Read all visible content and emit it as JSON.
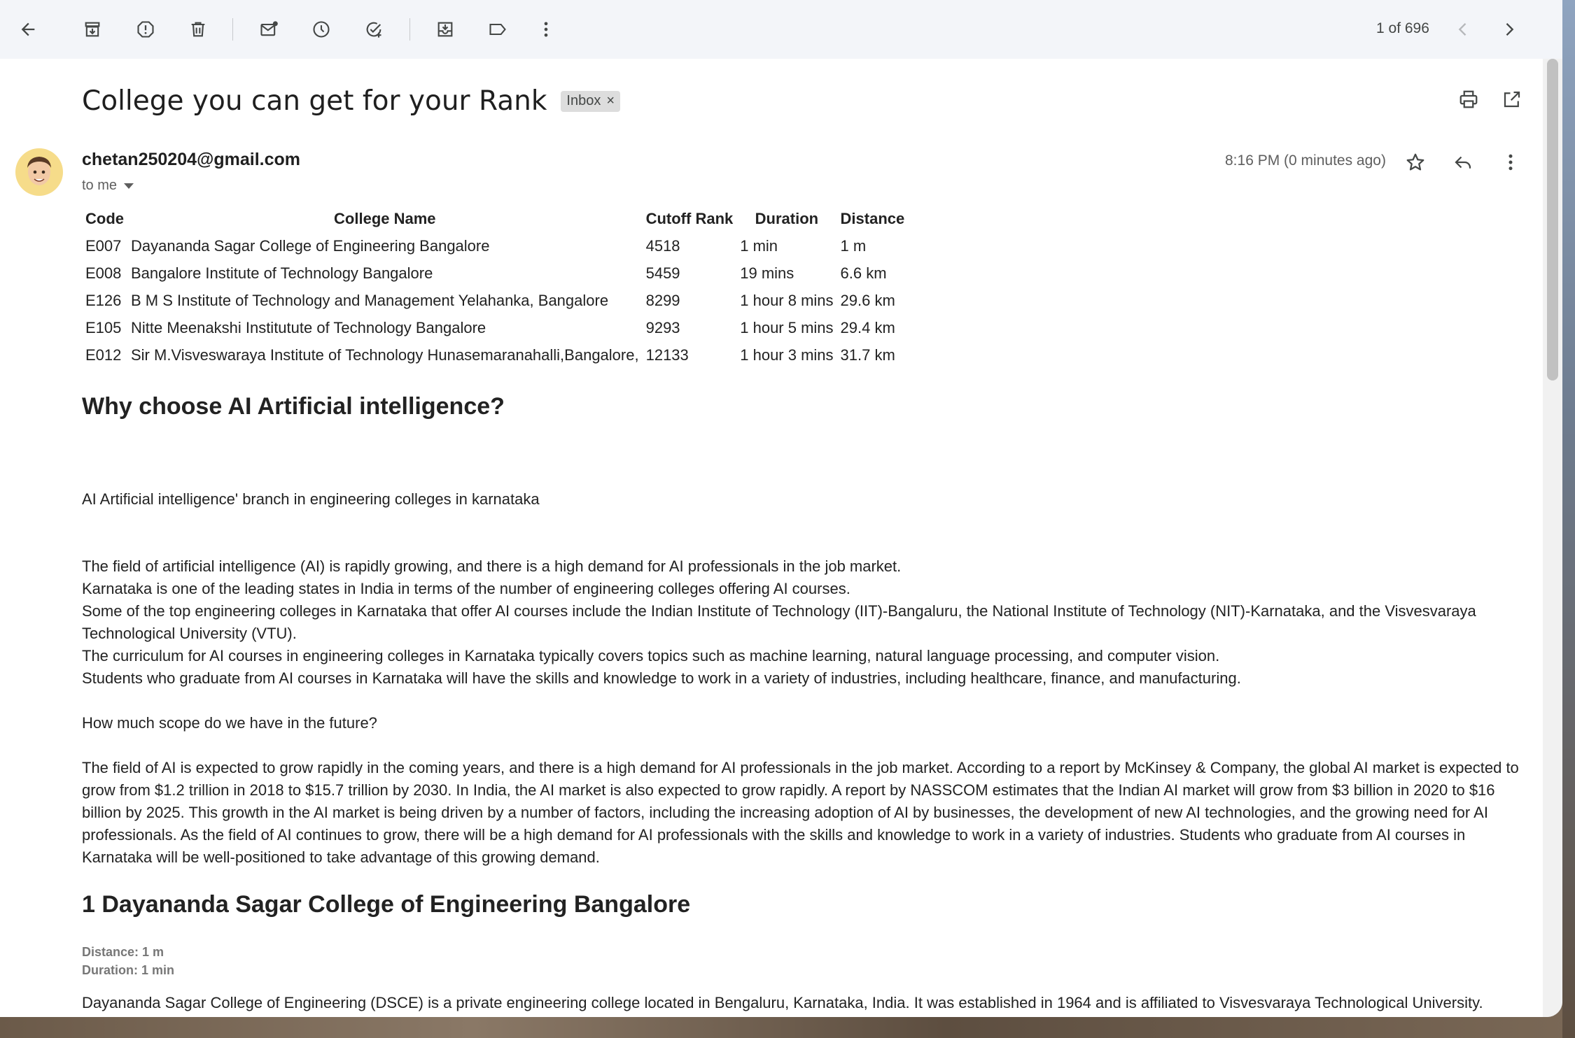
{
  "toolbar": {
    "counter": "1 of 696",
    "icons": [
      "back-arrow-icon",
      "archive-icon",
      "report-spam-icon",
      "delete-icon",
      "mark-unread-icon",
      "snooze-icon",
      "add-task-icon",
      "move-to-icon",
      "label-icon",
      "more-vert-icon",
      "chevron-left-icon",
      "chevron-right-icon"
    ]
  },
  "email": {
    "subject": "College you can get for your Rank",
    "label": "Inbox",
    "label_close": "×",
    "sender": "chetan250204@gmail.com",
    "to": "to me",
    "time": "8:16 PM (0 minutes ago)"
  },
  "table": {
    "headers": [
      "Code",
      "College Name",
      "Cutoff Rank",
      "Duration",
      "Distance"
    ],
    "rows": [
      [
        "E007",
        "Dayananda Sagar College of Engineering Bangalore",
        "4518",
        "1 min",
        "1 m"
      ],
      [
        "E008",
        "Bangalore Institute of Technology Bangalore",
        "5459",
        "19 mins",
        "6.6 km"
      ],
      [
        "E126",
        "B M S Institute of Technology and Management Yelahanka, Bangalore",
        "8299",
        "1 hour 8 mins",
        "29.6 km"
      ],
      [
        "E105",
        "Nitte Meenakshi Institutute of Technology Bangalore",
        "9293",
        "1 hour 5 mins",
        "29.4 km"
      ],
      [
        "E012",
        "Sir M.Visveswaraya Institute of Technology Hunasemaranahalli,Bangalore,",
        "12133",
        "1 hour 3 mins",
        "31.7 km"
      ]
    ]
  },
  "body": {
    "heading1": "Why choose AI Artificial intelligence?",
    "branch_line": "AI Artificial intelligence' branch in engineering colleges in karnataka",
    "para1": [
      "The field of artificial intelligence (AI) is rapidly growing, and there is a high demand for AI professionals in the job market.",
      "Karnataka is one of the leading states in India in terms of the number of engineering colleges offering AI courses.",
      "Some of the top engineering colleges in Karnataka that offer AI courses include the Indian Institute of Technology (IIT)-Bangaluru, the National Institute of Technology (NIT)-Karnataka, and the Visvesvaraya Technological University (VTU).",
      "The curriculum for AI courses in engineering colleges in Karnataka typically covers topics such as machine learning, natural language processing, and computer vision.",
      "Students who graduate from AI courses in Karnataka will have the skills and knowledge to work in a variety of industries, including healthcare, finance, and manufacturing."
    ],
    "scope_question": "How much scope do we have in the future?",
    "scope_para": "The field of AI is expected to grow rapidly in the coming years, and there is a high demand for AI professionals in the job market. According to a report by McKinsey & Company, the global AI market is expected to grow from $1.2 trillion in 2018 to $15.7 trillion by 2030. In India, the AI market is also expected to grow rapidly. A report by NASSCOM estimates that the Indian AI market will grow from $3 billion in 2020 to $16 billion by 2025. This growth in the AI market is being driven by a number of factors, including the increasing adoption of AI by businesses, the development of new AI technologies, and the growing need for AI professionals. As the field of AI continues to grow, there will be a high demand for AI professionals with the skills and knowledge to work in a variety of industries. Students who graduate from AI courses in Karnataka will be well-positioned to take advantage of this growing demand.",
    "heading2": "1 Dayananda Sagar College of Engineering Bangalore",
    "distance": "Distance: 1 m",
    "duration": "Duration: 1 min",
    "college_para": "Dayananda Sagar College of Engineering (DSCE) is a private engineering college located in Bengaluru, Karnataka, India. It was established in 1964 and is affiliated to Visvesvaraya Technological University."
  }
}
